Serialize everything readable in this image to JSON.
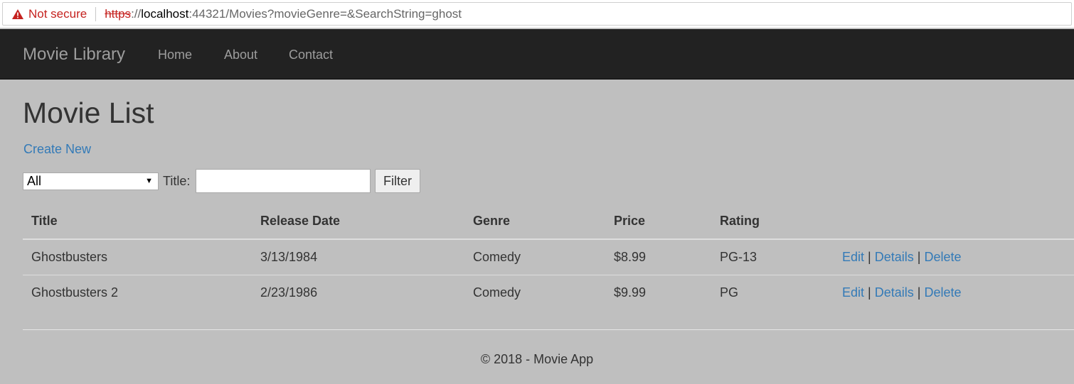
{
  "browser": {
    "security_label": "Not secure",
    "url_scheme": "https",
    "url_colon": "://",
    "url_host": "localhost",
    "url_rest": ":44321/Movies?movieGenre=&SearchString=ghost",
    "warning_icon": "warning-triangle-icon"
  },
  "navbar": {
    "brand": "Movie Library",
    "links": [
      "Home",
      "About",
      "Contact"
    ]
  },
  "main": {
    "title": "Movie List",
    "create_link": "Create New",
    "filter": {
      "genre_selected": "All",
      "title_label": "Title:",
      "title_value": "",
      "button_label": "Filter"
    },
    "table": {
      "headers": [
        "Title",
        "Release Date",
        "Genre",
        "Price",
        "Rating"
      ],
      "rows": [
        {
          "title": "Ghostbusters",
          "release_date": "3/13/1984",
          "genre": "Comedy",
          "price": "$8.99",
          "rating": "PG-13"
        },
        {
          "title": "Ghostbusters 2",
          "release_date": "2/23/1986",
          "genre": "Comedy",
          "price": "$9.99",
          "rating": "PG"
        }
      ],
      "actions": {
        "edit": "Edit",
        "details": "Details",
        "delete": "Delete",
        "separator": "|"
      }
    }
  },
  "footer": {
    "text": "© 2018 - Movie App"
  },
  "colors": {
    "link": "#337ab7",
    "navbar_bg": "#222222",
    "page_bg": "#bfbfbf",
    "warning": "#c5221f"
  }
}
